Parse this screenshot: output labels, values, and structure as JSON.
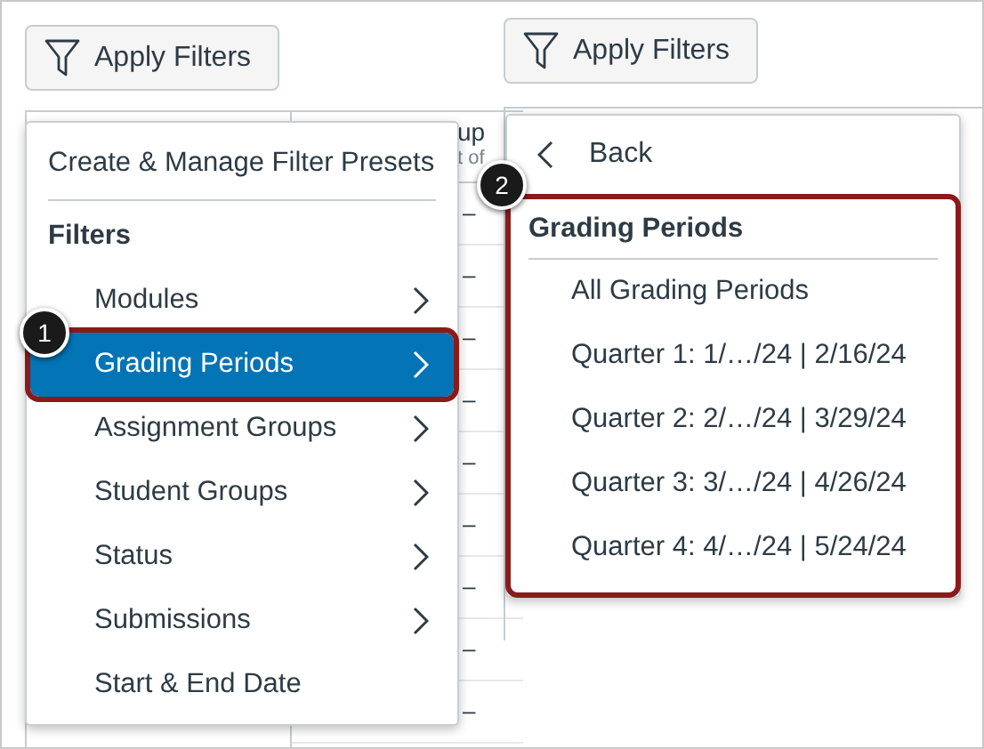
{
  "left": {
    "button": "Apply Filters",
    "header": [
      "up",
      "t of"
    ],
    "rows": [
      "–",
      "–",
      "–",
      "–",
      "–",
      "–",
      "–",
      "–",
      "–"
    ],
    "menu": {
      "action": "Create & Manage Filter Presets",
      "section": "Filters",
      "items": [
        {
          "label": "Modules",
          "submenu": true,
          "selected": false
        },
        {
          "label": "Grading Periods",
          "submenu": true,
          "selected": true
        },
        {
          "label": "Assignment Groups",
          "submenu": true,
          "selected": false
        },
        {
          "label": "Student Groups",
          "submenu": true,
          "selected": false
        },
        {
          "label": "Status",
          "submenu": true,
          "selected": false
        },
        {
          "label": "Submissions",
          "submenu": true,
          "selected": false
        },
        {
          "label": "Start & End Date",
          "submenu": false,
          "selected": false
        }
      ]
    },
    "callout": "1"
  },
  "right": {
    "button": "Apply Filters",
    "back": "Back",
    "section": "Grading Periods",
    "items": [
      "All Grading Periods",
      "Quarter 1: 1/…/24 | 2/16/24",
      "Quarter 2: 2/…/24 | 3/29/24",
      "Quarter 3: 3/…/24 | 4/26/24",
      "Quarter 4: 4/…/24 | 5/24/24"
    ],
    "callout": "2"
  }
}
